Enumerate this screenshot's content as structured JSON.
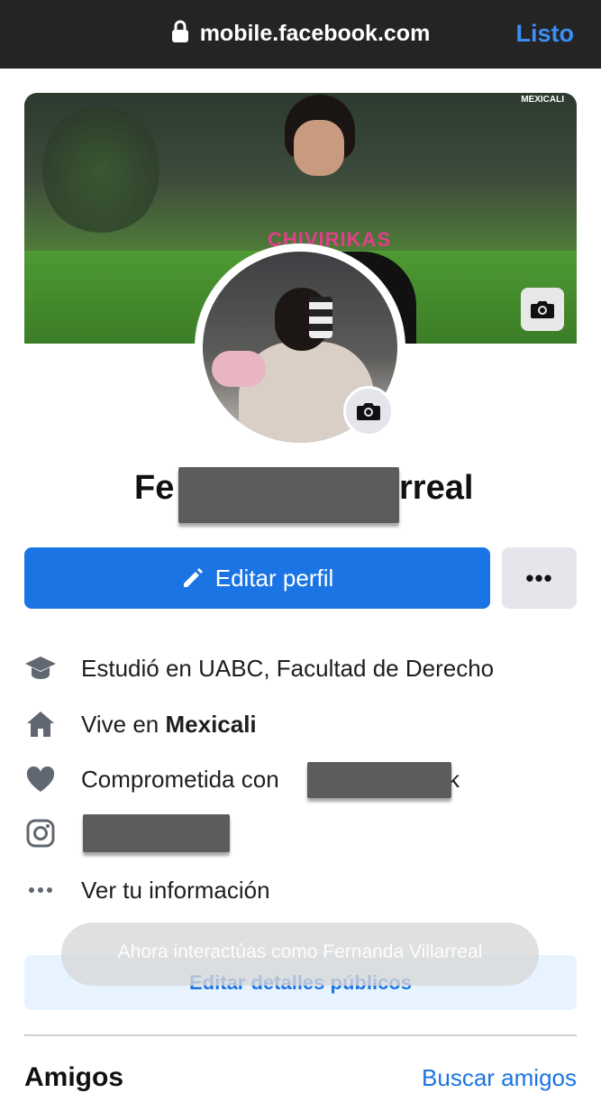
{
  "browser": {
    "url": "mobile.facebook.com",
    "done_label": "Listo"
  },
  "cover": {
    "brand_text": "MEXICALI",
    "shirt_text": "CHIVIRIKAS"
  },
  "profile": {
    "name_visible_start": "Fe",
    "name_visible_end": "rreal"
  },
  "actions": {
    "edit_profile_label": "Editar perfil",
    "more_label": "•••"
  },
  "details": {
    "education": "Estudió en UABC, Facultad de Derecho",
    "lives_prefix": "Vive en ",
    "lives_city": "Mexicali",
    "relationship_prefix": "Comprometida con",
    "relationship_tail": "k",
    "see_info": "Ver tu información"
  },
  "toast": {
    "text": "Ahora interactúas como Fernanda Villarreal"
  },
  "public_details_label": "Editar detalles públicos",
  "friends": {
    "title": "Amigos",
    "find_label": "Buscar amigos"
  }
}
